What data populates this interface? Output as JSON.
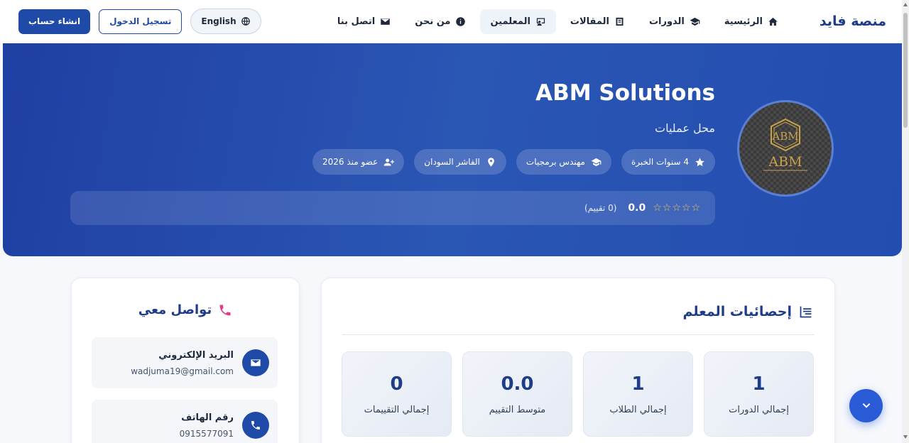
{
  "nav": {
    "brand": "منصة فايد",
    "links": [
      {
        "label": "الرئيسية",
        "icon": "home-icon"
      },
      {
        "label": "الدورات",
        "icon": "graduation-cap-icon"
      },
      {
        "label": "المقالات",
        "icon": "book-icon"
      },
      {
        "label": "المعلمين",
        "icon": "teacher-icon",
        "active": true
      },
      {
        "label": "من نحن",
        "icon": "info-icon"
      },
      {
        "label": "اتصل بنا",
        "icon": "envelope-icon"
      }
    ],
    "lang_label": "English",
    "login_label": "تسجيل الدخول",
    "signup_label": "انشاء حساب"
  },
  "profile": {
    "name": "ABM Solutions",
    "subtitle": "محل عمليات",
    "avatar_text": "ABM",
    "avatar_caption": "ABM",
    "badges": [
      {
        "label": "4 سنوات الخبرة",
        "icon": "star-icon"
      },
      {
        "label": "مهندس برمجيات",
        "icon": "graduation-cap-icon"
      },
      {
        "label": "الفاشر السودان",
        "icon": "map-pin-icon"
      },
      {
        "label": "عضو منذ 2026",
        "icon": "user-plus-icon"
      }
    ],
    "rating": {
      "stars": "☆☆☆☆☆",
      "value": "0.0",
      "count_text": "(0 تقييم)"
    }
  },
  "stats": {
    "title": "إحصائيات المعلم",
    "items": [
      {
        "value": "1",
        "label": "إجمالي الدورات"
      },
      {
        "value": "1",
        "label": "إجمالي الطلاب"
      },
      {
        "value": "0.0",
        "label": "متوسط التقييم"
      },
      {
        "value": "0",
        "label": "إجمالي التقييمات"
      }
    ]
  },
  "contact": {
    "title": "تواصل معي",
    "email_label": "البريد الإلكتروني",
    "email_value": "wadjuma19@gmail.com",
    "phone_label": "رقم الهاتف",
    "phone_value": "0915577091"
  },
  "colors": {
    "primary": "#1f4aa8",
    "brand": "#1f3c88",
    "hero_gradient_start": "#1f3fa3",
    "accent_pink": "#e23d8a",
    "star_gold": "#f5c44e"
  }
}
